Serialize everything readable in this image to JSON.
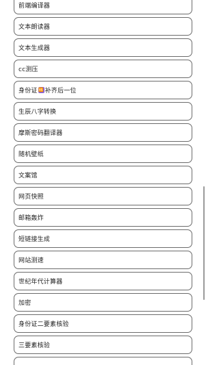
{
  "tools": {
    "items": [
      {
        "label": "前端编译器"
      },
      {
        "label": "文本朗读器"
      },
      {
        "label": "文本生成器"
      },
      {
        "label": "cc测压"
      },
      {
        "label_before": "身份证",
        "label_badge": "🆚",
        "label_after": "补齐后一位"
      },
      {
        "label": "生辰八字转换"
      },
      {
        "label": "摩斯密码翻译器"
      },
      {
        "label": "随机壁纸"
      },
      {
        "label": "文案馆"
      },
      {
        "label": "网页快照"
      },
      {
        "label": "邮箱轰炸"
      },
      {
        "label": "短链接生成"
      },
      {
        "label": "网站测速"
      },
      {
        "label": "世纪年代计算器"
      },
      {
        "label": "加密"
      },
      {
        "label": "身份证二要素核验"
      },
      {
        "label": "三要素核验"
      },
      {
        "label": ""
      }
    ]
  },
  "colors": {
    "border": "#6b6b6b",
    "text": "#222222",
    "badge": "#8a63d2",
    "scrollbar": "#9a9a9a"
  }
}
